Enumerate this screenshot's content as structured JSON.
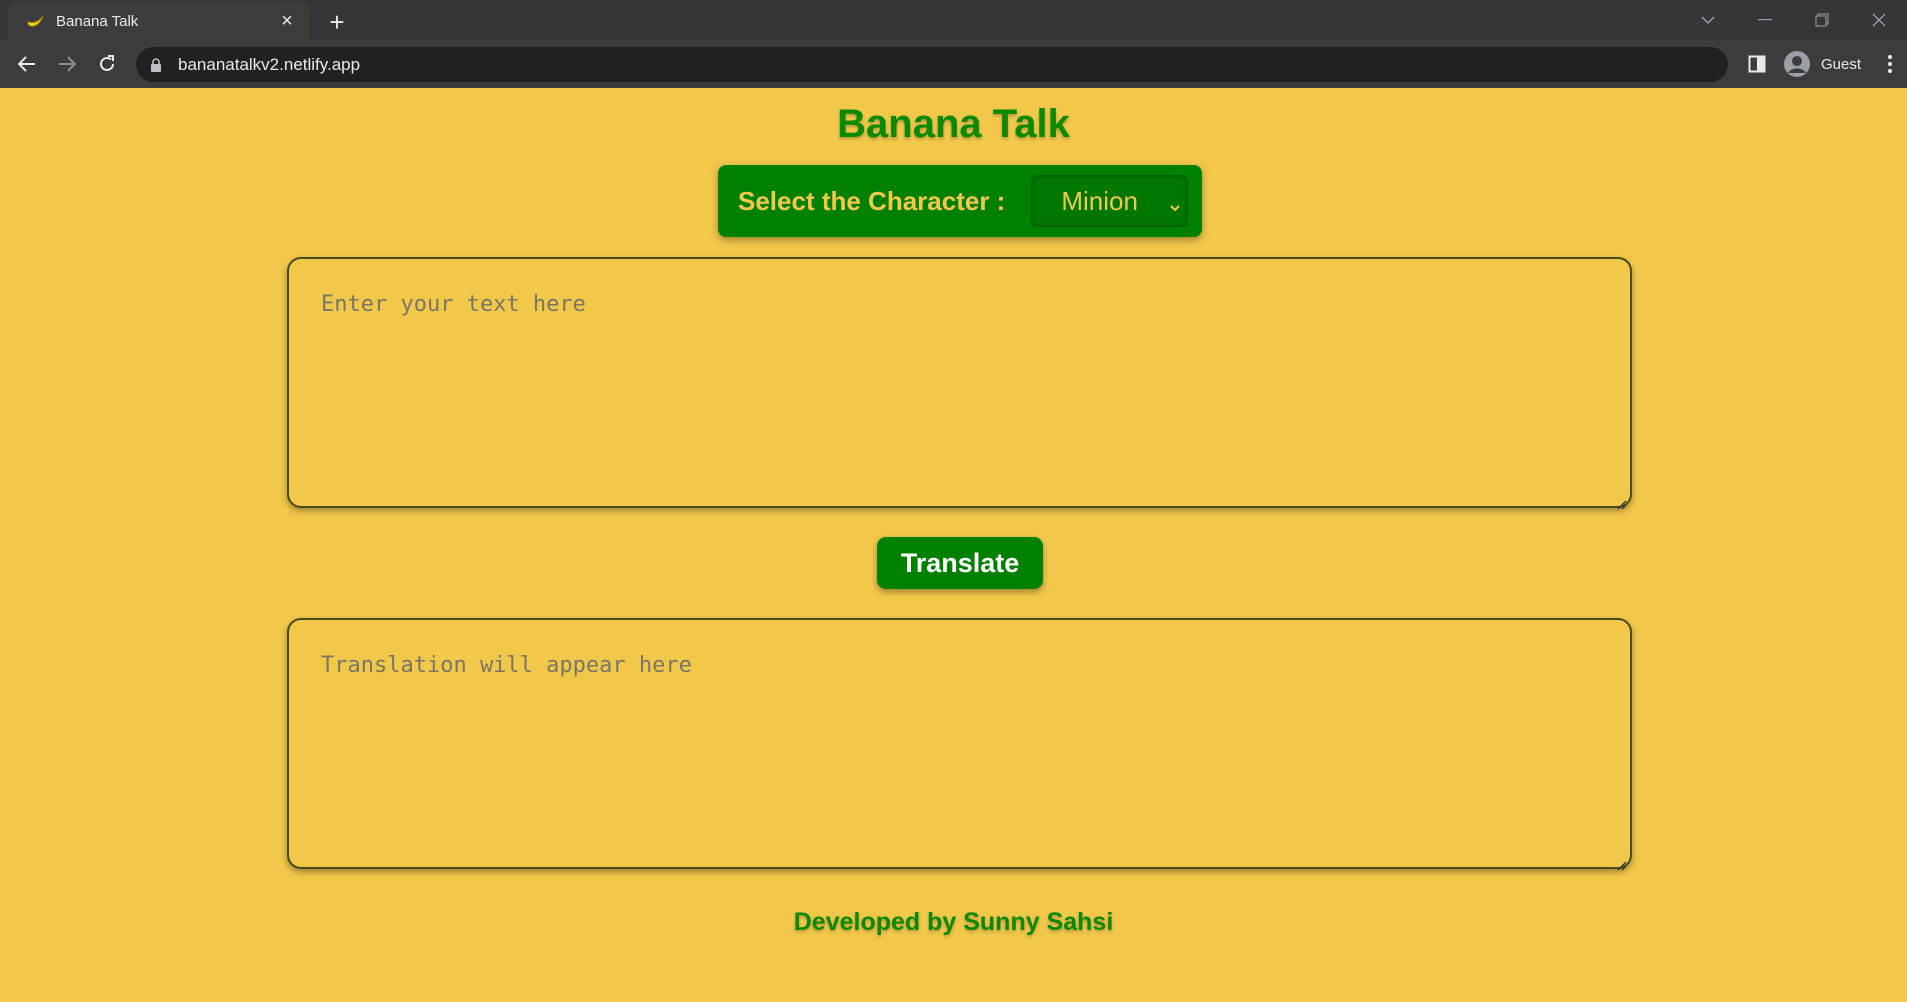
{
  "browser": {
    "tab_title": "Banana Talk",
    "url": "bananatalkv2.netlify.app",
    "profile_label": "Guest"
  },
  "app": {
    "title": "Banana Talk",
    "select_label": "Select the Character :",
    "selected_character": "Minion",
    "input_placeholder": "Enter your text here",
    "output_placeholder": "Translation will appear here",
    "translate_label": "Translate",
    "footer": "Developed by Sunny Sahsi"
  },
  "colors": {
    "background": "#f2c84b",
    "accent_green": "#008000",
    "heading_green": "#0b8a00"
  }
}
